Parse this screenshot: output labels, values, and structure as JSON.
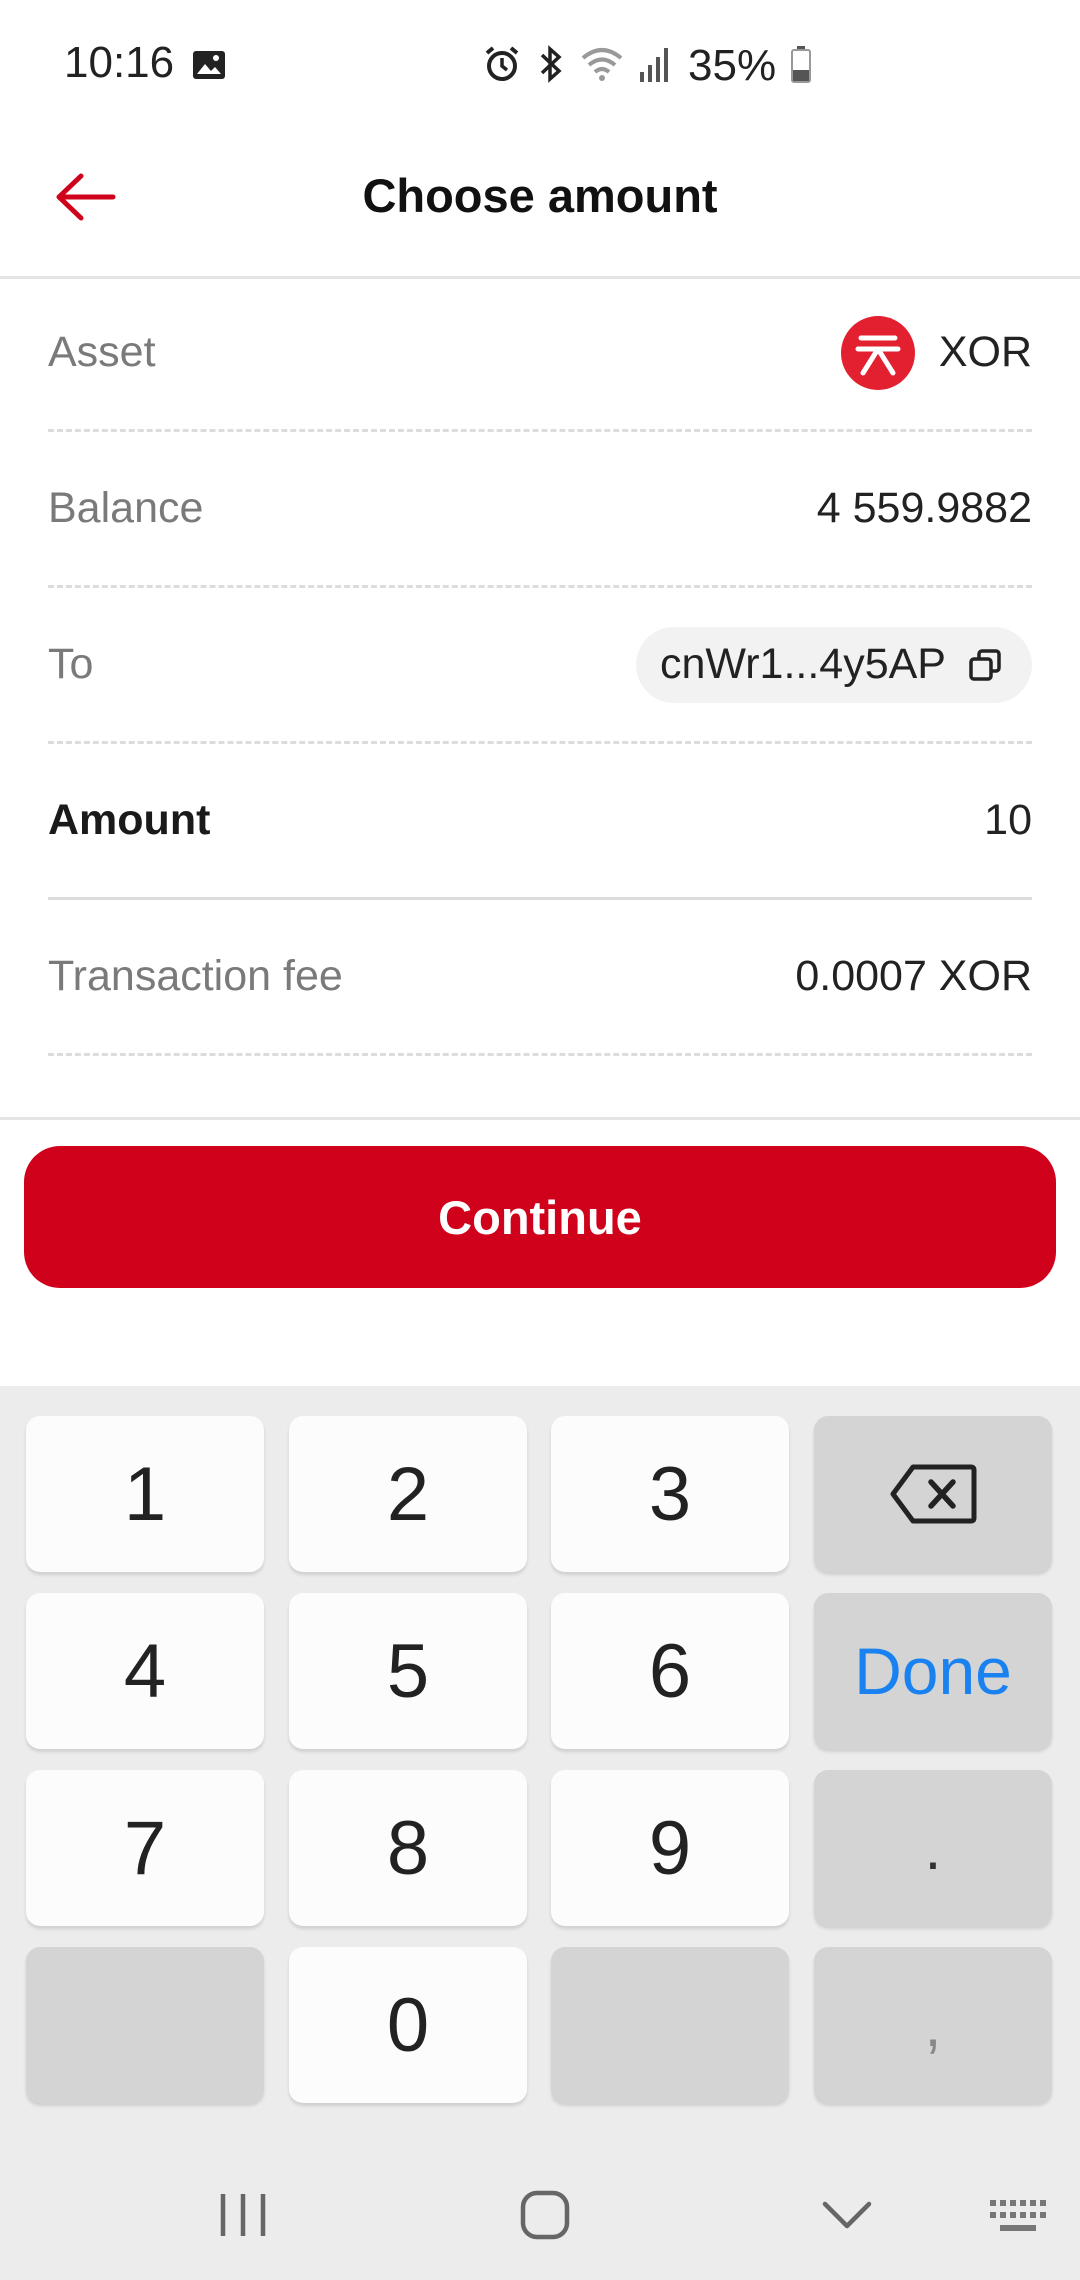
{
  "status_bar": {
    "time": "10:16",
    "battery_percent": "35%",
    "icons": [
      "gallery-icon",
      "alarm-icon",
      "bluetooth-icon",
      "wifi-icon",
      "signal-icon",
      "battery-icon"
    ]
  },
  "header": {
    "title": "Choose amount",
    "back_icon": "arrow-left-icon"
  },
  "form": {
    "asset": {
      "label": "Asset",
      "value": "XOR",
      "icon": "xor-logo-icon"
    },
    "balance": {
      "label": "Balance",
      "value": "4 559.9882"
    },
    "to": {
      "label": "To",
      "value": "cnWr1...4y5AP",
      "icon": "copy-icon"
    },
    "amount": {
      "label": "Amount",
      "value": "10"
    },
    "fee": {
      "label": "Transaction fee",
      "value": "0.0007 XOR"
    }
  },
  "continue_label": "Continue",
  "keyboard": {
    "keys": [
      "1",
      "2",
      "3",
      "4",
      "5",
      "6",
      "7",
      "8",
      "9",
      "0"
    ],
    "backspace_icon": "backspace-icon",
    "done_label": "Done",
    "dot_label": ".",
    "comma_label": ","
  },
  "nav_bar": {
    "icons": [
      "recent-apps-icon",
      "home-icon",
      "hide-keyboard-icon",
      "keyboard-switch-icon"
    ]
  },
  "colors": {
    "accent": "#d0021b",
    "xor_logo": "#e3202f",
    "done_blue": "#1a82f0",
    "keyboard_bg": "#ececec"
  }
}
